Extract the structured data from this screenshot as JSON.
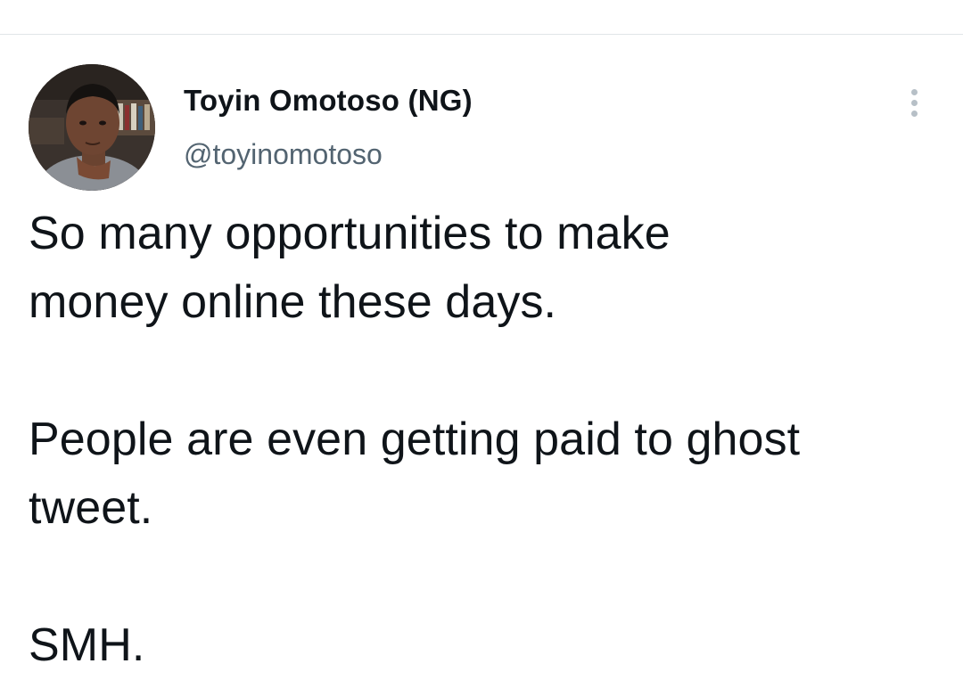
{
  "tweet": {
    "author": {
      "display_name": "Toyin Omotoso (NG)",
      "handle": "@toyinomotoso"
    },
    "more_icon": "more-vertical-icon",
    "lines": [
      "So many opportunities to make",
      "money online these days.",
      "",
      "People are even getting paid to ghost",
      "tweet.",
      "",
      "SMH."
    ]
  },
  "colors": {
    "text": "#0f1419",
    "secondary_text": "#536471",
    "divider": "#e1e5e8",
    "icon_muted": "#b7c0c7",
    "background": "#ffffff"
  }
}
